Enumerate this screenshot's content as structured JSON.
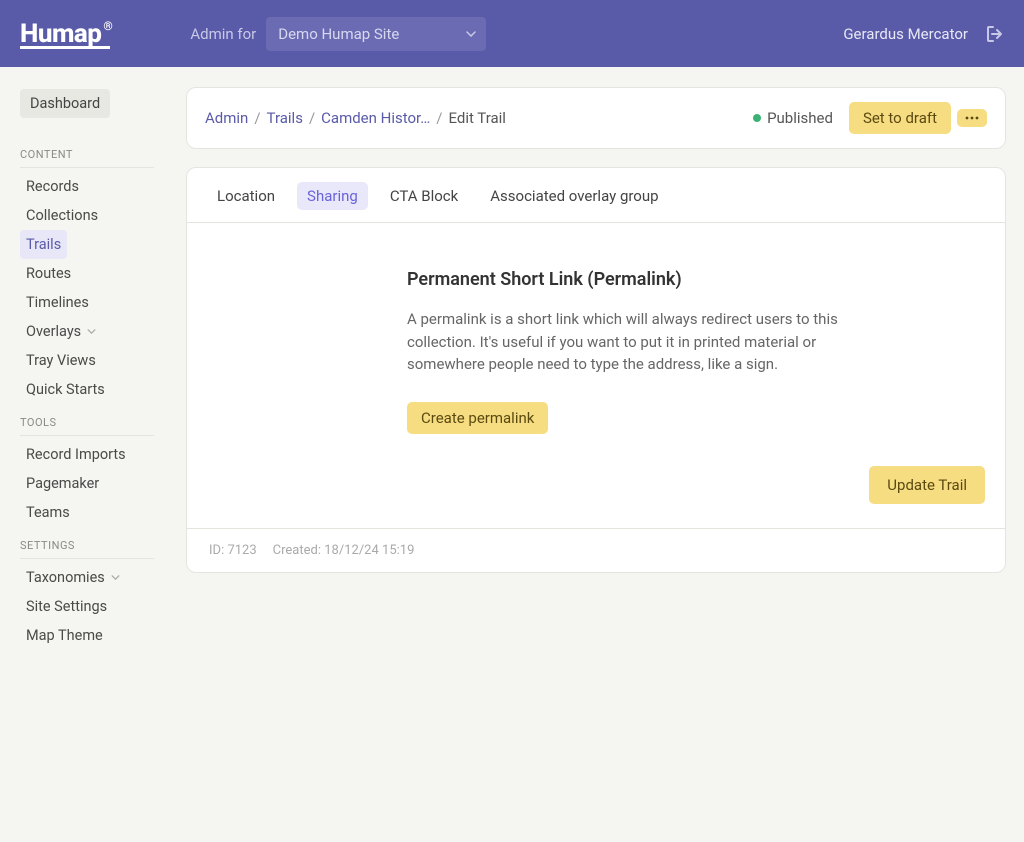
{
  "header": {
    "logo_text": "Humap",
    "admin_for_label": "Admin for",
    "site_name": "Demo Humap Site",
    "username": "Gerardus Mercator"
  },
  "sidebar": {
    "dashboard": "Dashboard",
    "sections": {
      "content": {
        "title": "CONTENT",
        "items": [
          "Records",
          "Collections",
          "Trails",
          "Routes",
          "Timelines",
          "Overlays",
          "Tray Views",
          "Quick Starts"
        ],
        "active_index": 2,
        "dropdown_indices": [
          5
        ]
      },
      "tools": {
        "title": "TOOLS",
        "items": [
          "Record Imports",
          "Pagemaker",
          "Teams"
        ]
      },
      "settings": {
        "title": "SETTINGS",
        "items": [
          "Taxonomies",
          "Site Settings",
          "Map Theme"
        ],
        "dropdown_indices": [
          0
        ]
      }
    }
  },
  "breadcrumb": {
    "items": [
      "Admin",
      "Trails",
      "Camden Histor…"
    ],
    "current": "Edit Trail"
  },
  "status": {
    "label": "Published",
    "color": "#3bb273"
  },
  "actions": {
    "set_draft": "Set to draft"
  },
  "tabs": {
    "items": [
      "Location",
      "Sharing",
      "CTA Block",
      "Associated overlay group"
    ],
    "active_index": 1
  },
  "panel": {
    "heading": "Permanent Short Link (Permalink)",
    "body": "A permalink is a short link which will always redirect users to this collection. It's useful if you want to put it in printed material or somewhere people need to type the address, like a sign.",
    "create_button": "Create permalink"
  },
  "update_button": "Update Trail",
  "meta": {
    "id_label": "ID: 7123",
    "created_label": "Created: 18/12/24 15:19"
  }
}
